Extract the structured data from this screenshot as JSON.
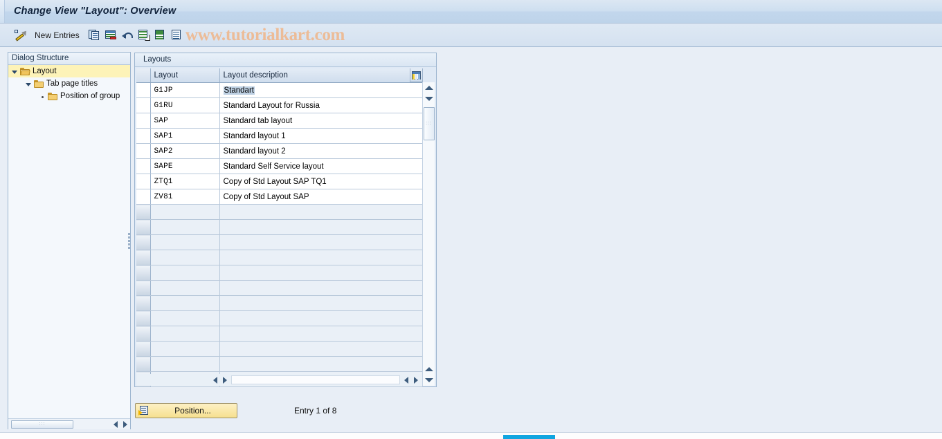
{
  "window": {
    "title": "Change View \"Layout\": Overview"
  },
  "toolbar": {
    "new_entries_label": "New Entries",
    "icons": [
      {
        "name": "edit-pencil-icon"
      },
      {
        "name": "copy-entry-icon"
      },
      {
        "name": "delete-entry-icon"
      },
      {
        "name": "undo-icon"
      },
      {
        "name": "select-all-icon"
      },
      {
        "name": "deselect-all-icon"
      },
      {
        "name": "details-icon"
      }
    ]
  },
  "watermark": {
    "text": "www.tutorialkart.com",
    "color": "#f0b588"
  },
  "tree": {
    "header": "Dialog Structure",
    "items": [
      {
        "label": "Layout",
        "level": 0,
        "twisty": "expanded",
        "folder": "open",
        "selected": true
      },
      {
        "label": "Tab page titles",
        "level": 1,
        "twisty": "expanded",
        "folder": "closed",
        "selected": false
      },
      {
        "label": "Position of group",
        "level": 2,
        "twisty": "leaf",
        "folder": "closed",
        "selected": false
      }
    ],
    "scroll_left_icon": "scroll-left-icon",
    "scroll_right_icon": "scroll-right-icon"
  },
  "grid": {
    "title": "Layouts",
    "columns": [
      "Layout",
      "Layout description"
    ],
    "config_icon": "column-config-icon",
    "rows": [
      {
        "layout": "G1JP",
        "description": "Standart",
        "selected_text": true
      },
      {
        "layout": "G1RU",
        "description": "Standard Layout for Russia",
        "selected_text": false
      },
      {
        "layout": "SAP",
        "description": "Standard tab layout",
        "selected_text": false
      },
      {
        "layout": "SAP1",
        "description": "Standard layout 1",
        "selected_text": false
      },
      {
        "layout": "SAP2",
        "description": "Standard layout 2",
        "selected_text": false
      },
      {
        "layout": "SAPE",
        "description": "Standard Self Service layout",
        "selected_text": false
      },
      {
        "layout": "ZTQ1",
        "description": "Copy of Std Layout SAP TQ1",
        "selected_text": false
      },
      {
        "layout": "ZV81",
        "description": "Copy of Std Layout SAP",
        "selected_text": false
      }
    ],
    "empty_row_count": 13,
    "scroll": {
      "up_icon": "scroll-up-icon",
      "down_icon": "scroll-down-icon",
      "left_icon": "scroll-left-icon",
      "right_icon": "scroll-right-icon"
    }
  },
  "footer": {
    "position_button_label": "Position...",
    "position_button_icon": "position-icon",
    "entry_info": "Entry 1 of 8",
    "accent_color": "#f6e08f"
  }
}
